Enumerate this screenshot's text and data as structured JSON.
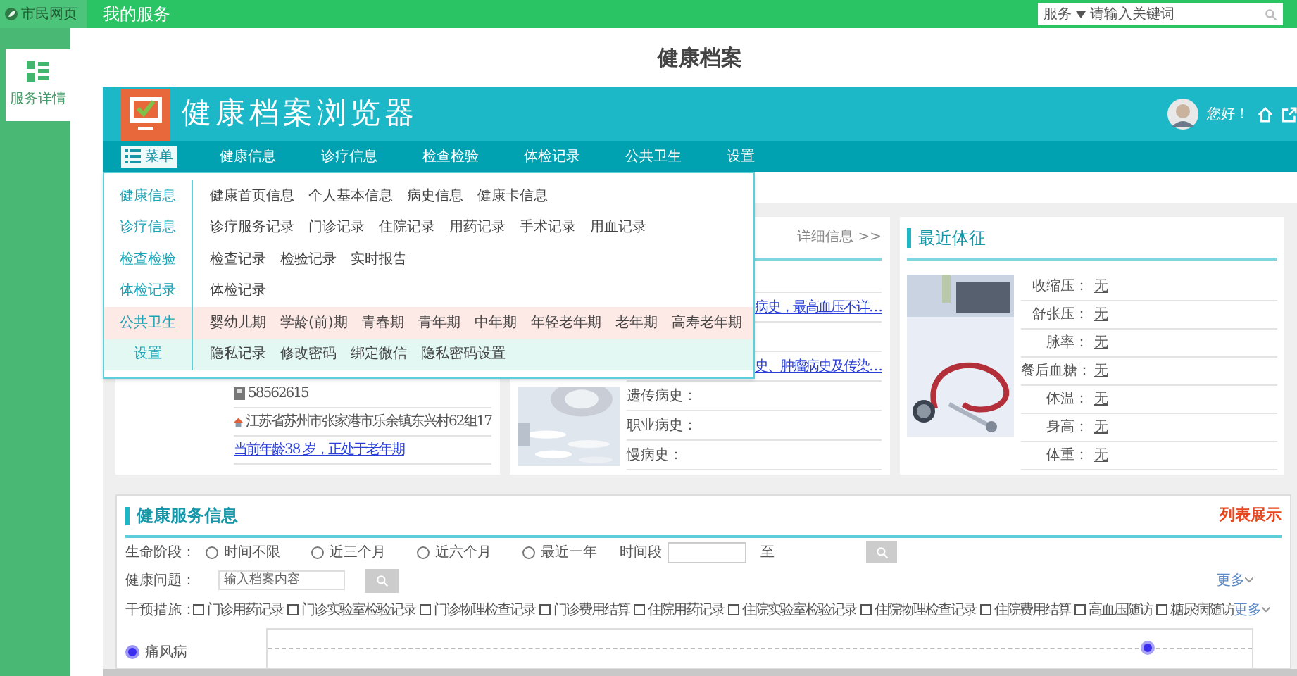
{
  "top_bar": {
    "logo": "市民网页",
    "title": "我的服务",
    "search": {
      "scope": "服务",
      "placeholder": "请输入关键词"
    }
  },
  "sidebar": {
    "items": [
      {
        "label": "服务详情",
        "selected": true
      }
    ]
  },
  "page_title": "健康档案",
  "app": {
    "title": "健康档案浏览器",
    "greeting": "您好！",
    "nav": [
      {
        "label": "菜单",
        "selected": true
      },
      {
        "label": "健康信息",
        "selected": false
      },
      {
        "label": "诊疗信息",
        "selected": false
      },
      {
        "label": "检查检验",
        "selected": false
      },
      {
        "label": "体检记录",
        "selected": false
      },
      {
        "label": "公共卫生",
        "selected": false
      },
      {
        "label": "设置",
        "selected": false
      }
    ],
    "menu": [
      {
        "category": "健康信息",
        "items": [
          "健康首页信息",
          "个人基本信息",
          "病史信息",
          "健康卡信息"
        ]
      },
      {
        "category": "诊疗信息",
        "items": [
          "诊疗服务记录",
          "门诊记录",
          "住院记录",
          "用药记录",
          "手术记录",
          "用血记录"
        ]
      },
      {
        "category": "检查检验",
        "items": [
          "检查记录",
          "检验记录",
          "实时报告"
        ]
      },
      {
        "category": "体检记录",
        "items": [
          "体检记录"
        ]
      },
      {
        "category": "公共卫生",
        "color": "#fde9e5",
        "items": [
          "婴幼儿期",
          "学龄(前)期",
          "青春期",
          "青年期",
          "中年期",
          "年轻老年期",
          "老年期",
          "高寿老年期"
        ]
      },
      {
        "category": "设置",
        "color": "#e4f8f3",
        "items": [
          "隐私记录",
          "修改密码",
          "绑定微信",
          "隐私密码设置"
        ]
      }
    ]
  },
  "basic_card": {
    "rows": [
      {
        "kind": "phone",
        "text": "58562615"
      },
      {
        "kind": "address",
        "text": "江苏省苏州市张家港市乐余镇东兴村62组17"
      },
      {
        "kind": "link",
        "text": "当前年龄38 岁，正处于老年期"
      }
    ]
  },
  "history_card": {
    "more": "详细信息 >>",
    "rows": [
      {
        "kind": "blank"
      },
      {
        "kind": "link",
        "text": "病史，最高血压不详…"
      },
      {
        "kind": "blank"
      },
      {
        "kind": "link",
        "text": "史、肿瘤病史及传染…"
      },
      {
        "kind": "label",
        "text": "遗传病史："
      },
      {
        "kind": "label",
        "text": "职业病史："
      },
      {
        "kind": "label",
        "text": "慢病史："
      }
    ]
  },
  "vitals_card": {
    "title": "最近体征",
    "rows": [
      {
        "label": "收缩压：",
        "value": "无"
      },
      {
        "label": "舒张压：",
        "value": "无"
      },
      {
        "label": "脉率：",
        "value": "无"
      },
      {
        "label": "餐后血糖：",
        "value": "无"
      },
      {
        "label": "体温：",
        "value": "无"
      },
      {
        "label": "身高：",
        "value": "无"
      },
      {
        "label": "体重：",
        "value": "无"
      }
    ]
  },
  "service": {
    "title": "健康服务信息",
    "view": "列表展示",
    "stage": {
      "label": "生命阶段：",
      "options": [
        {
          "label": "时间不限",
          "selected": false
        },
        {
          "label": "近三个月",
          "selected": false
        },
        {
          "label": "近六个月",
          "selected": false
        },
        {
          "label": "最近一年",
          "selected": false
        }
      ],
      "range_label": "时间段",
      "to": "至"
    },
    "problem": {
      "label": "健康问题：",
      "placeholder": "输入档案内容",
      "more": "更多"
    },
    "measures": {
      "label": "干预措施：",
      "more": "更多",
      "options": [
        {
          "label": "门诊用药记录",
          "checked": false
        },
        {
          "label": "门诊实验室检验记录",
          "checked": false
        },
        {
          "label": "门诊物理检查记录",
          "checked": false
        },
        {
          "label": "门诊费用结算",
          "checked": false
        },
        {
          "label": "住院用药记录",
          "checked": false
        },
        {
          "label": "住院实验室检验记录",
          "checked": false
        },
        {
          "label": "住院物理检查记录",
          "checked": false
        },
        {
          "label": "住院费用结算",
          "checked": false
        },
        {
          "label": "高血压随访",
          "checked": false
        },
        {
          "label": "糖尿病随访",
          "checked": false
        }
      ]
    },
    "diseases": [
      {
        "label": "痛风病",
        "selected": true
      }
    ]
  }
}
